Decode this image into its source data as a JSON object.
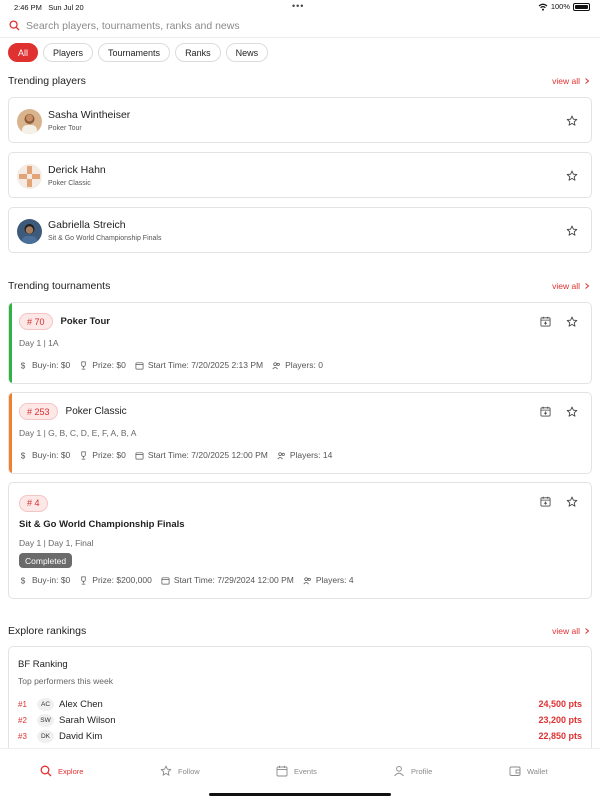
{
  "status_bar": {
    "time": "2:46 PM",
    "date": "Sun Jul 20",
    "dots": "•••",
    "battery": "100%"
  },
  "search": {
    "placeholder": "Search players, tournaments, ranks and news"
  },
  "filters": [
    "All",
    "Players",
    "Tournaments",
    "Ranks",
    "News"
  ],
  "active_filter": "All",
  "sections": {
    "trending_players": "Trending players",
    "trending_tournaments": "Trending tournaments",
    "explore_rankings": "Explore rankings",
    "view_all": "view all"
  },
  "players": [
    {
      "name": "Sasha Wintheiser",
      "subtitle": "Poker  Tour",
      "avatar": "photo-avatar"
    },
    {
      "name": "Derick Hahn",
      "subtitle": "Poker Classic",
      "avatar": "pattern-avatar"
    },
    {
      "name": "Gabriella Streich",
      "subtitle": "Sit & Go World Championship Finals",
      "avatar": "photo-avatar"
    }
  ],
  "tournaments": [
    {
      "tag": "# 70",
      "name": "Poker Tour",
      "day": "Day 1 | 1A",
      "accent": "#2fb344",
      "buy_in": "Buy-in: $0",
      "prize": "Prize: $0",
      "start": "Start Time: 7/20/2025 2:13 PM",
      "players": "Players: 0"
    },
    {
      "tag": "# 253",
      "name": "Poker Classic",
      "day": "Day 1 | G, B, C, D, E, F, A, B, A",
      "accent": "#f07f2e",
      "buy_in": "Buy-in: $0",
      "prize": "Prize: $0",
      "start": "Start Time: 7/20/2025 12:00 PM",
      "players": "Players: 14"
    },
    {
      "tag": "# 4",
      "name": "Sit & Go World Championship Finals",
      "day": "Day 1 | Day 1, Final",
      "status": "Completed",
      "buy_in": "Buy-in: $0",
      "prize": "Prize: $200,000",
      "start": "Start Time: 7/29/2024 12:00 PM",
      "players": "Players: 4"
    }
  ],
  "rankings": {
    "title": "BF Ranking",
    "subtitle": "Top performers this week",
    "rows": [
      {
        "pos": "#1",
        "initials": "AC",
        "name": "Alex Chen",
        "points": "24,500 pts"
      },
      {
        "pos": "#2",
        "initials": "SW",
        "name": "Sarah Wilson",
        "points": "23,200 pts"
      },
      {
        "pos": "#3",
        "initials": "DK",
        "name": "David Kim",
        "points": "22,850 pts"
      }
    ]
  },
  "tabs": [
    {
      "label": "Explore",
      "icon": "search-icon",
      "active": true
    },
    {
      "label": "Follow",
      "icon": "star-icon"
    },
    {
      "label": "Events",
      "icon": "calendar-icon"
    },
    {
      "label": "Profile",
      "icon": "user-icon"
    },
    {
      "label": "Wallet",
      "icon": "wallet-icon"
    }
  ],
  "colors": {
    "accent": "#e03131",
    "green": "#2fb344",
    "orange": "#f07f2e"
  }
}
